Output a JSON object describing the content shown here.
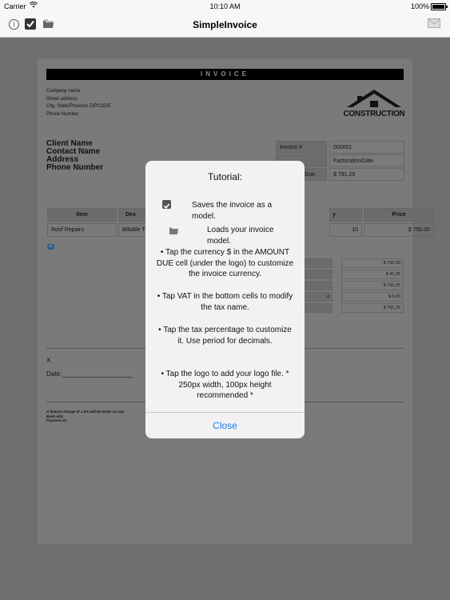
{
  "status_bar": {
    "carrier": "Carrier",
    "wifi_icon": "wifi-icon",
    "time": "10:10 AM",
    "battery": "100%",
    "battery_level": 1.0
  },
  "nav": {
    "title": "SimpleInvoice",
    "info_icon": "info-icon",
    "save_icon": "checkbox-icon",
    "load_icon": "folder-icon",
    "mail_icon": "mail-icon"
  },
  "invoice": {
    "banner": "INVOICE",
    "company": {
      "name": "Company name",
      "street": "Street address",
      "city": "City, State/Province ZIPCODE",
      "phone": "Phone Number"
    },
    "logo_text": "CONSTRUCTION",
    "client": {
      "name": "Client Name",
      "contact": "Contact Name",
      "address": "Address",
      "phone": "Phone Number"
    },
    "fields": [
      {
        "label": "Invoice #",
        "value": "000001"
      },
      {
        "label": "",
        "value": "FacturationDate"
      },
      {
        "label": "Due",
        "value": "$ 791.25"
      }
    ],
    "item_headers": [
      "Item",
      "Des",
      "y",
      "Price"
    ],
    "items": [
      {
        "item": "Roof Repairs",
        "desc": "Billable T",
        "qty": "10",
        "price": "$ 750.00"
      }
    ],
    "add_button": "+",
    "totals": [
      {
        "label": "",
        "value": "$ 750.00"
      },
      {
        "label": "",
        "value": "$ 41.25"
      },
      {
        "label": "",
        "value": "$ 791.25"
      },
      {
        "label": "d",
        "value": "$ 0.00"
      },
      {
        "label": "",
        "value": "$ 791.25"
      }
    ],
    "signature_x": "X",
    "signature_date": "Date:____________________",
    "footnote_1": "A finance charge of 1.5% will be made on unp",
    "footnote_2": "Bank info:",
    "footnote_3": "Payment id.:"
  },
  "tutorial": {
    "title": "Tutorial:",
    "line_save": "Saves the invoice as a model.",
    "line_load": "Loads your invoice model.",
    "para_currency": "• Tap the currency $ in the AMOUNT DUE cell (under the logo) to customize the invoice currency.",
    "para_vat": "• Tap VAT in the bottom cells to modify the tax name.",
    "para_tax": "• Tap the tax percentage to customize it. Use period for decimals.",
    "para_logo": "• Tap the logo to add your logo file. * 250px width, 100px height recommended *",
    "close_label": "Close"
  },
  "colors": {
    "accent": "#1a7cf2",
    "overlay": "#6f6f6f"
  }
}
